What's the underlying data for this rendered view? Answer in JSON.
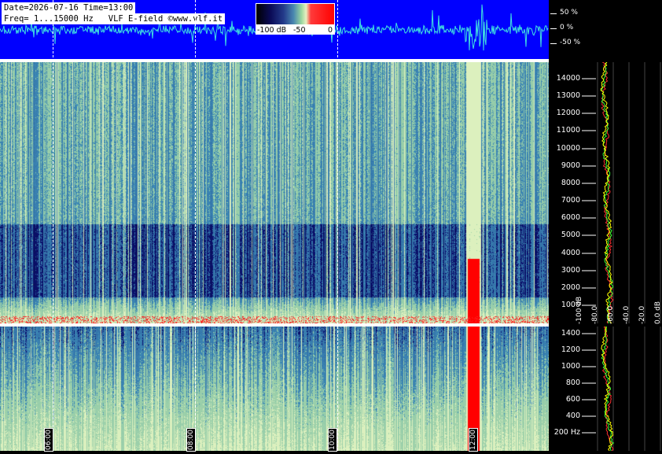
{
  "header": {
    "date_time": "Date=2026-07-16 Time=13:00",
    "freq_line": "Freq= 1...15000 Hz   VLF E-field ©www.vlf.it"
  },
  "colorbar": {
    "labels": [
      "-100 dB",
      "-50",
      "0"
    ]
  },
  "amplitude_axis": {
    "labels": [
      "50 %",
      "0 %",
      "-50 %"
    ]
  },
  "upper_freq_axis": {
    "labels": [
      "14000",
      "13000",
      "12000",
      "11000",
      "10000",
      "9000",
      "8000",
      "7000",
      "6000",
      "5000",
      "4000",
      "3000",
      "2000",
      "1000"
    ]
  },
  "lower_freq_axis": {
    "labels": [
      "1400",
      "1200",
      "1000",
      "800",
      "600",
      "400",
      "200 Hz"
    ]
  },
  "db_axis": {
    "labels": [
      "0.0 dB",
      "-20.0",
      "-40.0",
      "-60.0",
      "-80.0",
      "-100 dB"
    ]
  },
  "time_markers": [
    "06:00",
    "08:00",
    "10:00",
    "12:00"
  ],
  "colors": {
    "waveform_bg": "#0000ff",
    "trace": "#40e0e0",
    "spectrum_peak": "#ff0000",
    "avg_green": "#33ff33"
  }
}
